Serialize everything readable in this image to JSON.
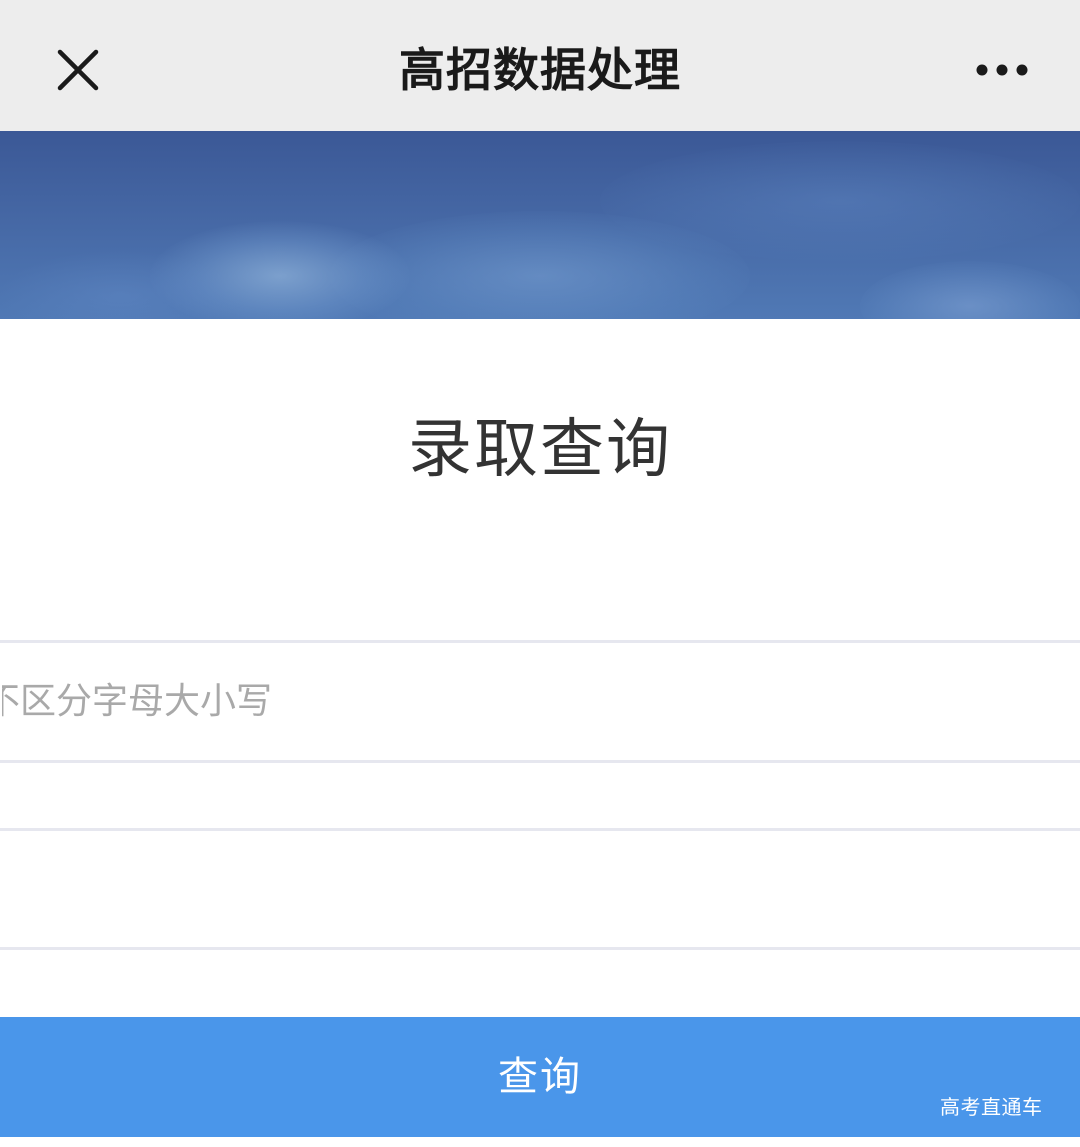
{
  "navbar": {
    "title": "高招数据处理",
    "close_icon": "close-icon",
    "more_icon": "more-horizontal-icon"
  },
  "banner": {
    "image": "sky-clouds-banner"
  },
  "main": {
    "heading": "录取查询",
    "fields": [
      {
        "placeholder": "不区分字母大小写",
        "value": ""
      },
      {
        "placeholder": "",
        "value": ""
      },
      {
        "placeholder": "",
        "value": ""
      }
    ],
    "submit_label": "查询"
  },
  "watermark": "高考直通车",
  "colors": {
    "navbar_bg": "#ededed",
    "button_bg": "#4a96ea",
    "divider": "#e6e7ef",
    "banner_top": "#3b5896",
    "banner_bottom": "#5079b5"
  }
}
